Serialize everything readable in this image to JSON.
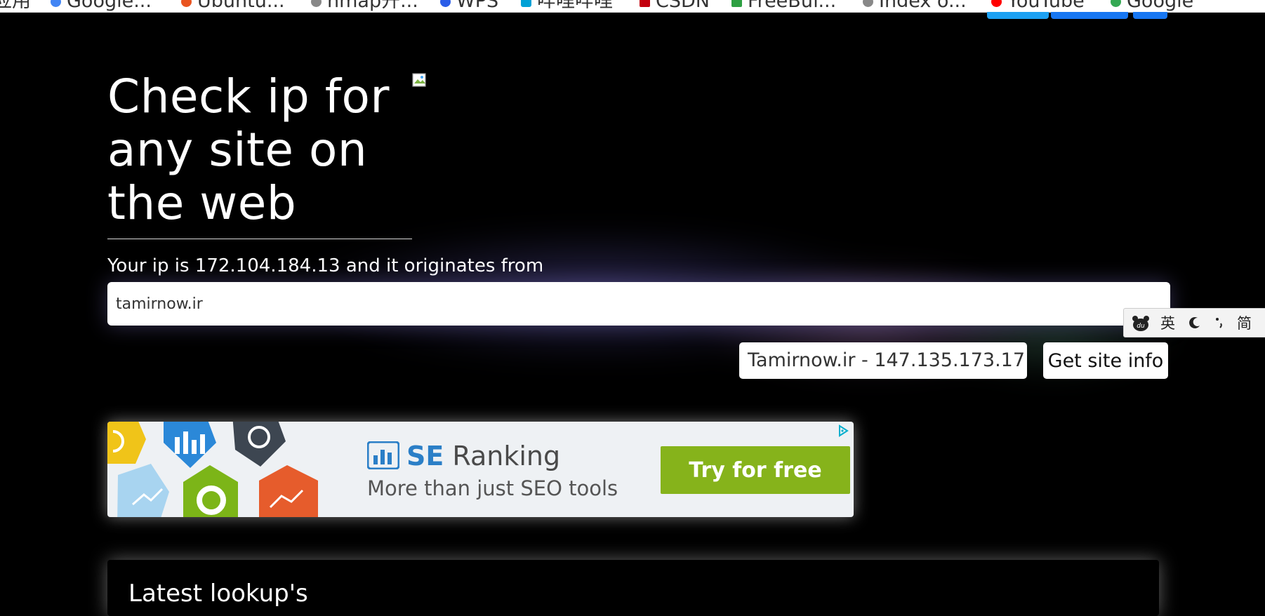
{
  "bookmarks": [
    {
      "label": "应用",
      "icon": "apps-icon",
      "color": "#444"
    },
    {
      "label": "Google...",
      "icon": "google-icon",
      "color": "#4285f4"
    },
    {
      "label": "Ubuntu...",
      "icon": "ubuntu-icon",
      "color": "#e95420"
    },
    {
      "label": "nmap开...",
      "icon": "globe-icon",
      "color": "#888888"
    },
    {
      "label": "WPS",
      "icon": "wps-icon",
      "color": "#2b5de8"
    },
    {
      "label": "哔哩哔哩",
      "icon": "bilibili-icon",
      "color": "#00a1d6"
    },
    {
      "label": "CSDN",
      "icon": "csdn-icon",
      "color": "#c3000d"
    },
    {
      "label": "FreeBuf...",
      "icon": "freebuf-icon",
      "color": "#2ea043"
    },
    {
      "label": "Index o...",
      "icon": "globe-icon",
      "color": "#888888"
    },
    {
      "label": "YouTube",
      "icon": "youtube-icon",
      "color": "#ff0000"
    },
    {
      "label": "Google",
      "icon": "google-icon",
      "color": "#34a853"
    }
  ],
  "share_buttons": [
    {
      "name": "twitter-share",
      "color": "#1da1f2"
    },
    {
      "name": "facebook-share",
      "color": "#1877f2"
    },
    {
      "name": "email-share",
      "color": "#1877f2"
    }
  ],
  "hero": {
    "title_line1": "Check ip for",
    "title_line2": "any site on",
    "title_line3": "the web",
    "ip_text": "Your ip is 172.104.184.13 and it originates from"
  },
  "lookup_form": {
    "input_value": "tamirnow.ir",
    "result_text": "Tamirnow.ir - 147.135.173.17 -",
    "submit_label": "Get site info"
  },
  "ad": {
    "brand_bold": "SE",
    "brand_rest": " Ranking",
    "tagline": "More than just SEO tools",
    "cta_label": "Try for free",
    "cta_color": "#86b31b",
    "brand_color": "#2b7fc7"
  },
  "lookups": {
    "heading": "Latest lookup's"
  },
  "ime": {
    "items": [
      "英",
      "简"
    ]
  }
}
